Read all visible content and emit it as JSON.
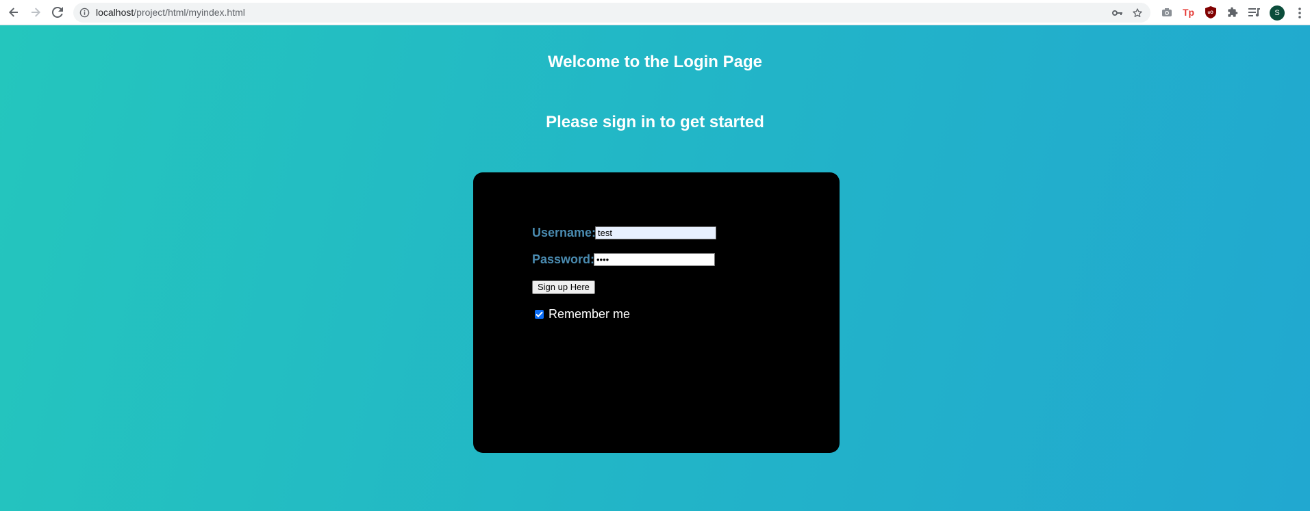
{
  "browser": {
    "url_host": "localhost",
    "url_path": "/project/html/myindex.html",
    "avatar_letter": "S",
    "icons": [
      "back-arrow-icon",
      "forward-arrow-icon",
      "reload-icon",
      "info-icon",
      "key-icon",
      "star-icon",
      "camera-icon",
      "tp-icon",
      "ublock-icon",
      "puzzle-icon",
      "playlist-icon",
      "menu-dots-icon"
    ]
  },
  "page": {
    "welcome_heading": "Welcome to the Login Page",
    "signin_heading": "Please sign in to get started",
    "background_colors": [
      "#24c6bd",
      "#21a8d0"
    ]
  },
  "login": {
    "username_label": "Username:",
    "username_value": "test",
    "password_label": "Password:",
    "password_value": "••••",
    "signup_label": "Sign up Here",
    "remember_label": "Remember me",
    "remember_checked": true,
    "label_color": "#4a8bb0",
    "card_color": "#000000"
  }
}
